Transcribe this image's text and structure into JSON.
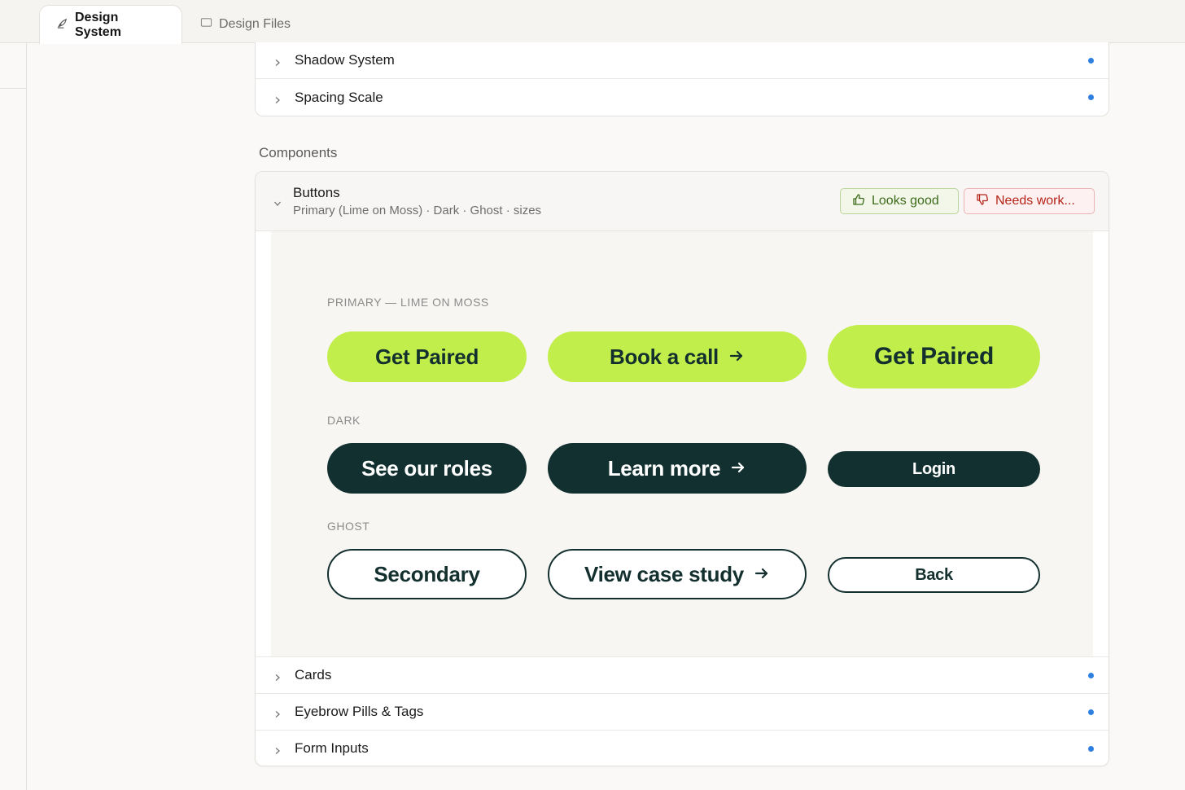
{
  "tabs": [
    {
      "label": "Design System",
      "icon": "leaf-pen-icon",
      "active": true
    },
    {
      "label": "Design Files",
      "icon": "folder-icon",
      "active": false
    }
  ],
  "top_rows": [
    {
      "label": "Shadow System"
    },
    {
      "label": "Spacing Scale"
    }
  ],
  "components_label": "Components",
  "buttons_section": {
    "title": "Buttons",
    "subtitle": "Primary (Lime on Moss) · Dark · Ghost · sizes",
    "looks_good": "Looks good",
    "needs_work": "Needs work...",
    "groups": {
      "primary": "PRIMARY — LIME ON MOSS",
      "dark": "DARK",
      "ghost": "GHOST"
    },
    "primary_buttons": [
      "Get Paired",
      "Book a call",
      "Get Paired"
    ],
    "dark_buttons": [
      "See our roles",
      "Learn more",
      "Login"
    ],
    "ghost_buttons": [
      "Secondary",
      "View case study",
      "Back"
    ]
  },
  "bottom_rows": [
    {
      "label": "Cards"
    },
    {
      "label": "Eyebrow Pills & Tags"
    },
    {
      "label": "Form Inputs"
    }
  ],
  "colors": {
    "lime": "#c1ee4a",
    "moss": "#133030",
    "status_dot": "#2f7fe0"
  }
}
